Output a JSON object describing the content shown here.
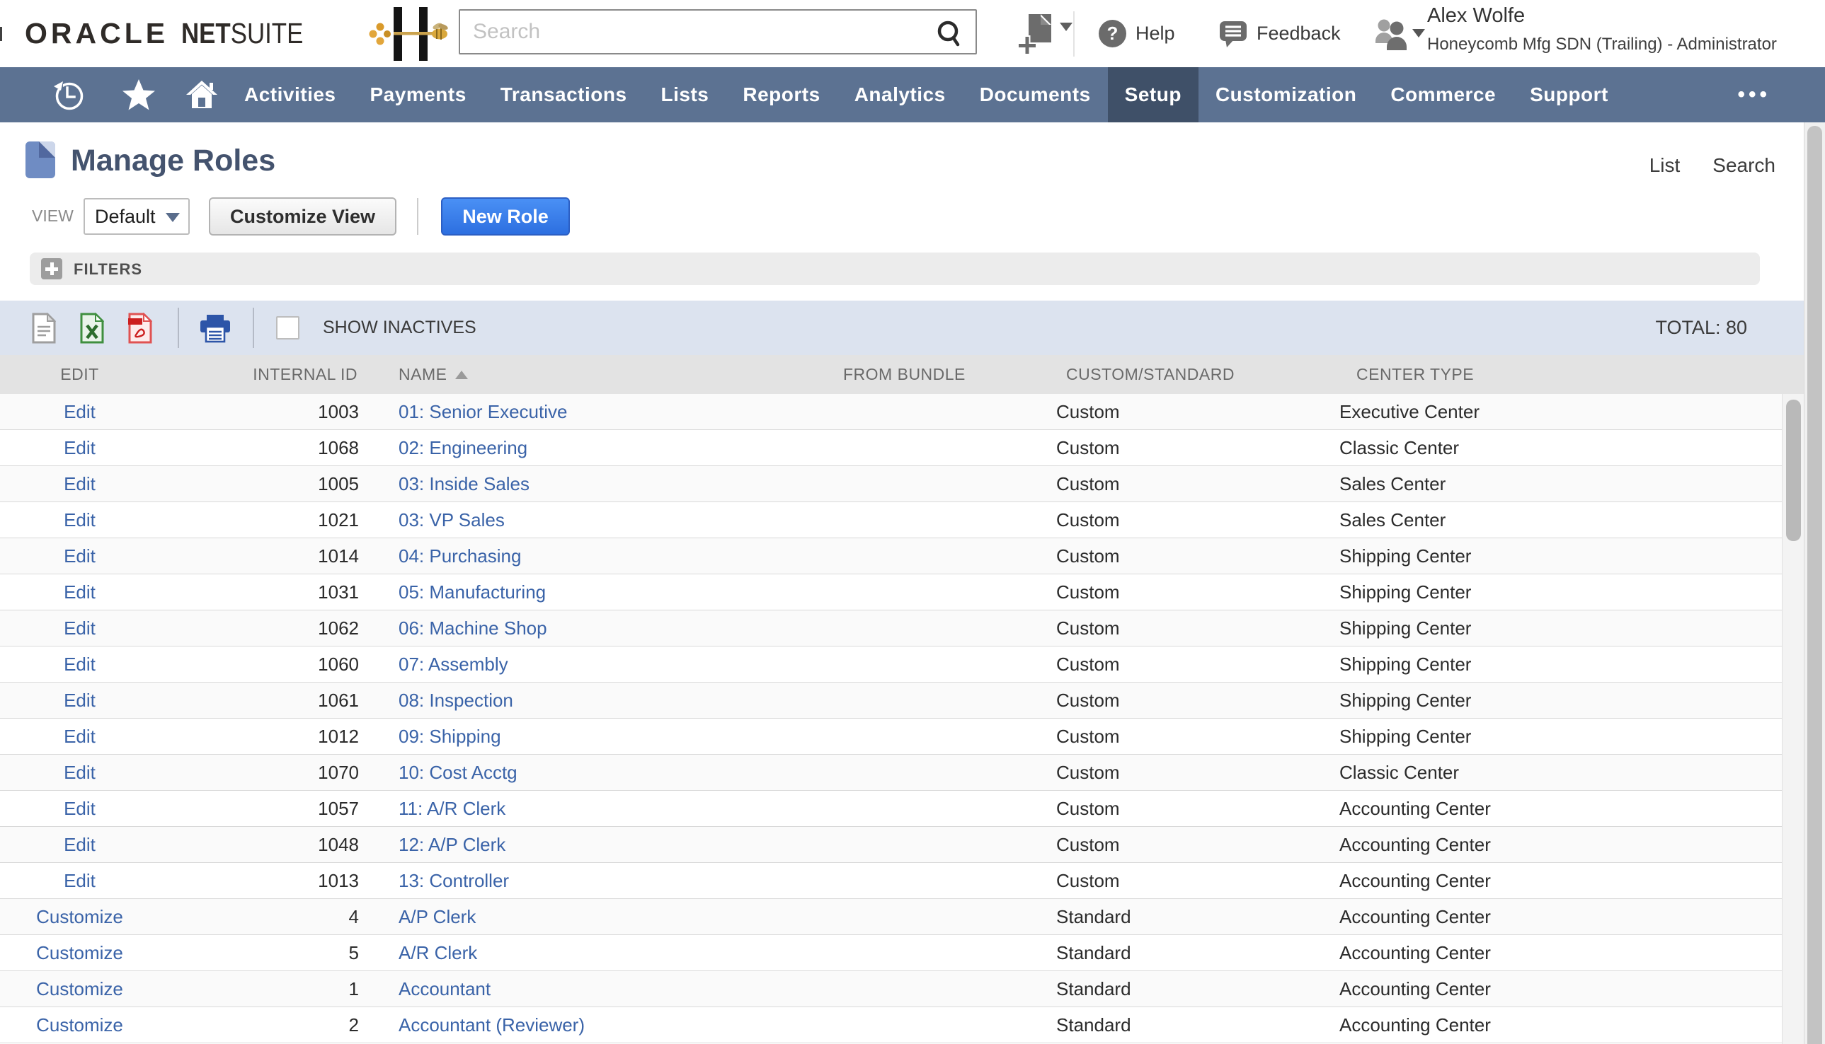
{
  "topbar": {
    "brand": {
      "part1": "ORACLE",
      "part2": "NET",
      "part3": "SUITE"
    },
    "search_placeholder": "Search",
    "help_label": "Help",
    "feedback_label": "Feedback",
    "user": {
      "name": "Alex Wolfe",
      "org": "Honeycomb Mfg SDN (Trailing) - Administrator"
    }
  },
  "nav": {
    "items": [
      {
        "label": "Activities"
      },
      {
        "label": "Payments"
      },
      {
        "label": "Transactions"
      },
      {
        "label": "Lists"
      },
      {
        "label": "Reports"
      },
      {
        "label": "Analytics"
      },
      {
        "label": "Documents"
      },
      {
        "label": "Setup",
        "active": true
      },
      {
        "label": "Customization"
      },
      {
        "label": "Commerce"
      },
      {
        "label": "Support"
      }
    ],
    "more_label": "•••"
  },
  "page": {
    "title": "Manage Roles",
    "list_link": "List",
    "search_link": "Search",
    "view_label": "VIEW",
    "view_value": "Default",
    "customize_view_label": "Customize View",
    "new_role_label": "New Role",
    "filters_label": "FILTERS"
  },
  "toolbar": {
    "show_inactives_label": "SHOW INACTIVES",
    "total_label": "TOTAL: 80",
    "export_icons": [
      "csv-export",
      "excel-export",
      "pdf-export",
      "print"
    ]
  },
  "table": {
    "columns": [
      "EDIT",
      "INTERNAL ID",
      "NAME",
      "FROM BUNDLE",
      "CUSTOM/STANDARD",
      "CENTER TYPE"
    ],
    "sort_column": "NAME",
    "sort_direction": "asc",
    "rows": [
      {
        "action": "Edit",
        "id": "1003",
        "name": "01: Senior Executive",
        "bundle": "",
        "custom_standard": "Custom",
        "center_type": "Executive Center"
      },
      {
        "action": "Edit",
        "id": "1068",
        "name": "02: Engineering",
        "bundle": "",
        "custom_standard": "Custom",
        "center_type": "Classic Center"
      },
      {
        "action": "Edit",
        "id": "1005",
        "name": "03: Inside Sales",
        "bundle": "",
        "custom_standard": "Custom",
        "center_type": "Sales Center"
      },
      {
        "action": "Edit",
        "id": "1021",
        "name": "03: VP Sales",
        "bundle": "",
        "custom_standard": "Custom",
        "center_type": "Sales Center"
      },
      {
        "action": "Edit",
        "id": "1014",
        "name": "04: Purchasing",
        "bundle": "",
        "custom_standard": "Custom",
        "center_type": "Shipping Center"
      },
      {
        "action": "Edit",
        "id": "1031",
        "name": "05: Manufacturing",
        "bundle": "",
        "custom_standard": "Custom",
        "center_type": "Shipping Center"
      },
      {
        "action": "Edit",
        "id": "1062",
        "name": "06: Machine Shop",
        "bundle": "",
        "custom_standard": "Custom",
        "center_type": "Shipping Center"
      },
      {
        "action": "Edit",
        "id": "1060",
        "name": "07: Assembly",
        "bundle": "",
        "custom_standard": "Custom",
        "center_type": "Shipping Center"
      },
      {
        "action": "Edit",
        "id": "1061",
        "name": "08: Inspection",
        "bundle": "",
        "custom_standard": "Custom",
        "center_type": "Shipping Center"
      },
      {
        "action": "Edit",
        "id": "1012",
        "name": "09: Shipping",
        "bundle": "",
        "custom_standard": "Custom",
        "center_type": "Shipping Center"
      },
      {
        "action": "Edit",
        "id": "1070",
        "name": "10: Cost Acctg",
        "bundle": "",
        "custom_standard": "Custom",
        "center_type": "Classic Center"
      },
      {
        "action": "Edit",
        "id": "1057",
        "name": "11: A/R Clerk",
        "bundle": "",
        "custom_standard": "Custom",
        "center_type": "Accounting Center"
      },
      {
        "action": "Edit",
        "id": "1048",
        "name": "12: A/P Clerk",
        "bundle": "",
        "custom_standard": "Custom",
        "center_type": "Accounting Center"
      },
      {
        "action": "Edit",
        "id": "1013",
        "name": "13: Controller",
        "bundle": "",
        "custom_standard": "Custom",
        "center_type": "Accounting Center"
      },
      {
        "action": "Customize",
        "id": "4",
        "name": "A/P Clerk",
        "bundle": "",
        "custom_standard": "Standard",
        "center_type": "Accounting Center"
      },
      {
        "action": "Customize",
        "id": "5",
        "name": "A/R Clerk",
        "bundle": "",
        "custom_standard": "Standard",
        "center_type": "Accounting Center"
      },
      {
        "action": "Customize",
        "id": "1",
        "name": "Accountant",
        "bundle": "",
        "custom_standard": "Standard",
        "center_type": "Accounting Center"
      },
      {
        "action": "Customize",
        "id": "2",
        "name": "Accountant (Reviewer)",
        "bundle": "",
        "custom_standard": "Standard",
        "center_type": "Accounting Center"
      }
    ]
  },
  "colors": {
    "nav_bg": "#5c7292",
    "nav_active_bg": "#3f5068",
    "toolbar_bg": "#dce3ef",
    "link_blue": "#3a63a8",
    "primary_button_blue": "#2d6fe0",
    "title_color": "#44536e"
  }
}
